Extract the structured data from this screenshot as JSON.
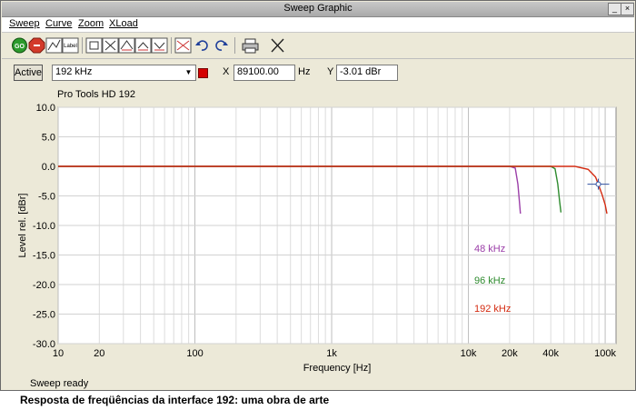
{
  "window": {
    "title": "Sweep Graphic"
  },
  "menu": {
    "items": [
      "Sweep",
      "Curve",
      "Zoom",
      "XLoad"
    ]
  },
  "toolbar": {
    "go_label": "GO",
    "label_label": "Label"
  },
  "controls": {
    "active_label": "Active",
    "curve_select": "192 kHz",
    "curve_color": "#d40000",
    "x_label": "X",
    "x_value": "89100.00",
    "x_unit": "Hz",
    "y_label": "Y",
    "y_value": "-3.01 dBr"
  },
  "status": "Sweep ready",
  "caption": "Resposta de freqüências da interface 192: uma obra de arte",
  "chart_data": {
    "type": "line",
    "title": "Pro Tools HD 192",
    "xlabel": "Frequency [Hz]",
    "ylabel": "Level rel. [dBr]",
    "xscale": "log",
    "xlim": [
      10,
      120000
    ],
    "ylim": [
      -30,
      10
    ],
    "xticks": [
      10,
      20,
      100,
      1000,
      10000,
      20000,
      40000,
      100000
    ],
    "xtick_labels": [
      "10",
      "20",
      "100",
      "1k",
      "10k",
      "20k",
      "40k",
      "100k"
    ],
    "yticks": [
      10,
      5,
      0,
      -5,
      -10,
      -15,
      -20,
      -25,
      -30
    ],
    "ytick_labels": [
      "10.0",
      "5.0",
      "0.0",
      "-5.0",
      "-10.0",
      "-15.0",
      "-20.0",
      "-25.0",
      "-30.0"
    ],
    "grid": true,
    "cursor": {
      "x": 89100,
      "y": -3.01
    },
    "series": [
      {
        "name": "48 kHz",
        "color": "#9b3ea8",
        "x": [
          10,
          100,
          1000,
          10000,
          20000,
          22000,
          23000,
          23600,
          24000
        ],
        "y": [
          0,
          0,
          0,
          0,
          0,
          -0.3,
          -3,
          -6,
          -8
        ]
      },
      {
        "name": "96 kHz",
        "color": "#2e8b2e",
        "x": [
          10,
          100,
          1000,
          10000,
          40000,
          43000,
          45000,
          46500,
          47500
        ],
        "y": [
          0,
          0,
          0,
          0,
          0,
          -0.4,
          -3,
          -6,
          -7.8
        ]
      },
      {
        "name": "192 kHz",
        "color": "#d42a10",
        "x": [
          10,
          100,
          1000,
          10000,
          60000,
          75000,
          85000,
          89100,
          95000,
          100000,
          103000
        ],
        "y": [
          0,
          0,
          0,
          0,
          0,
          -0.5,
          -1.8,
          -3.01,
          -4.8,
          -6.5,
          -8
        ]
      }
    ]
  }
}
